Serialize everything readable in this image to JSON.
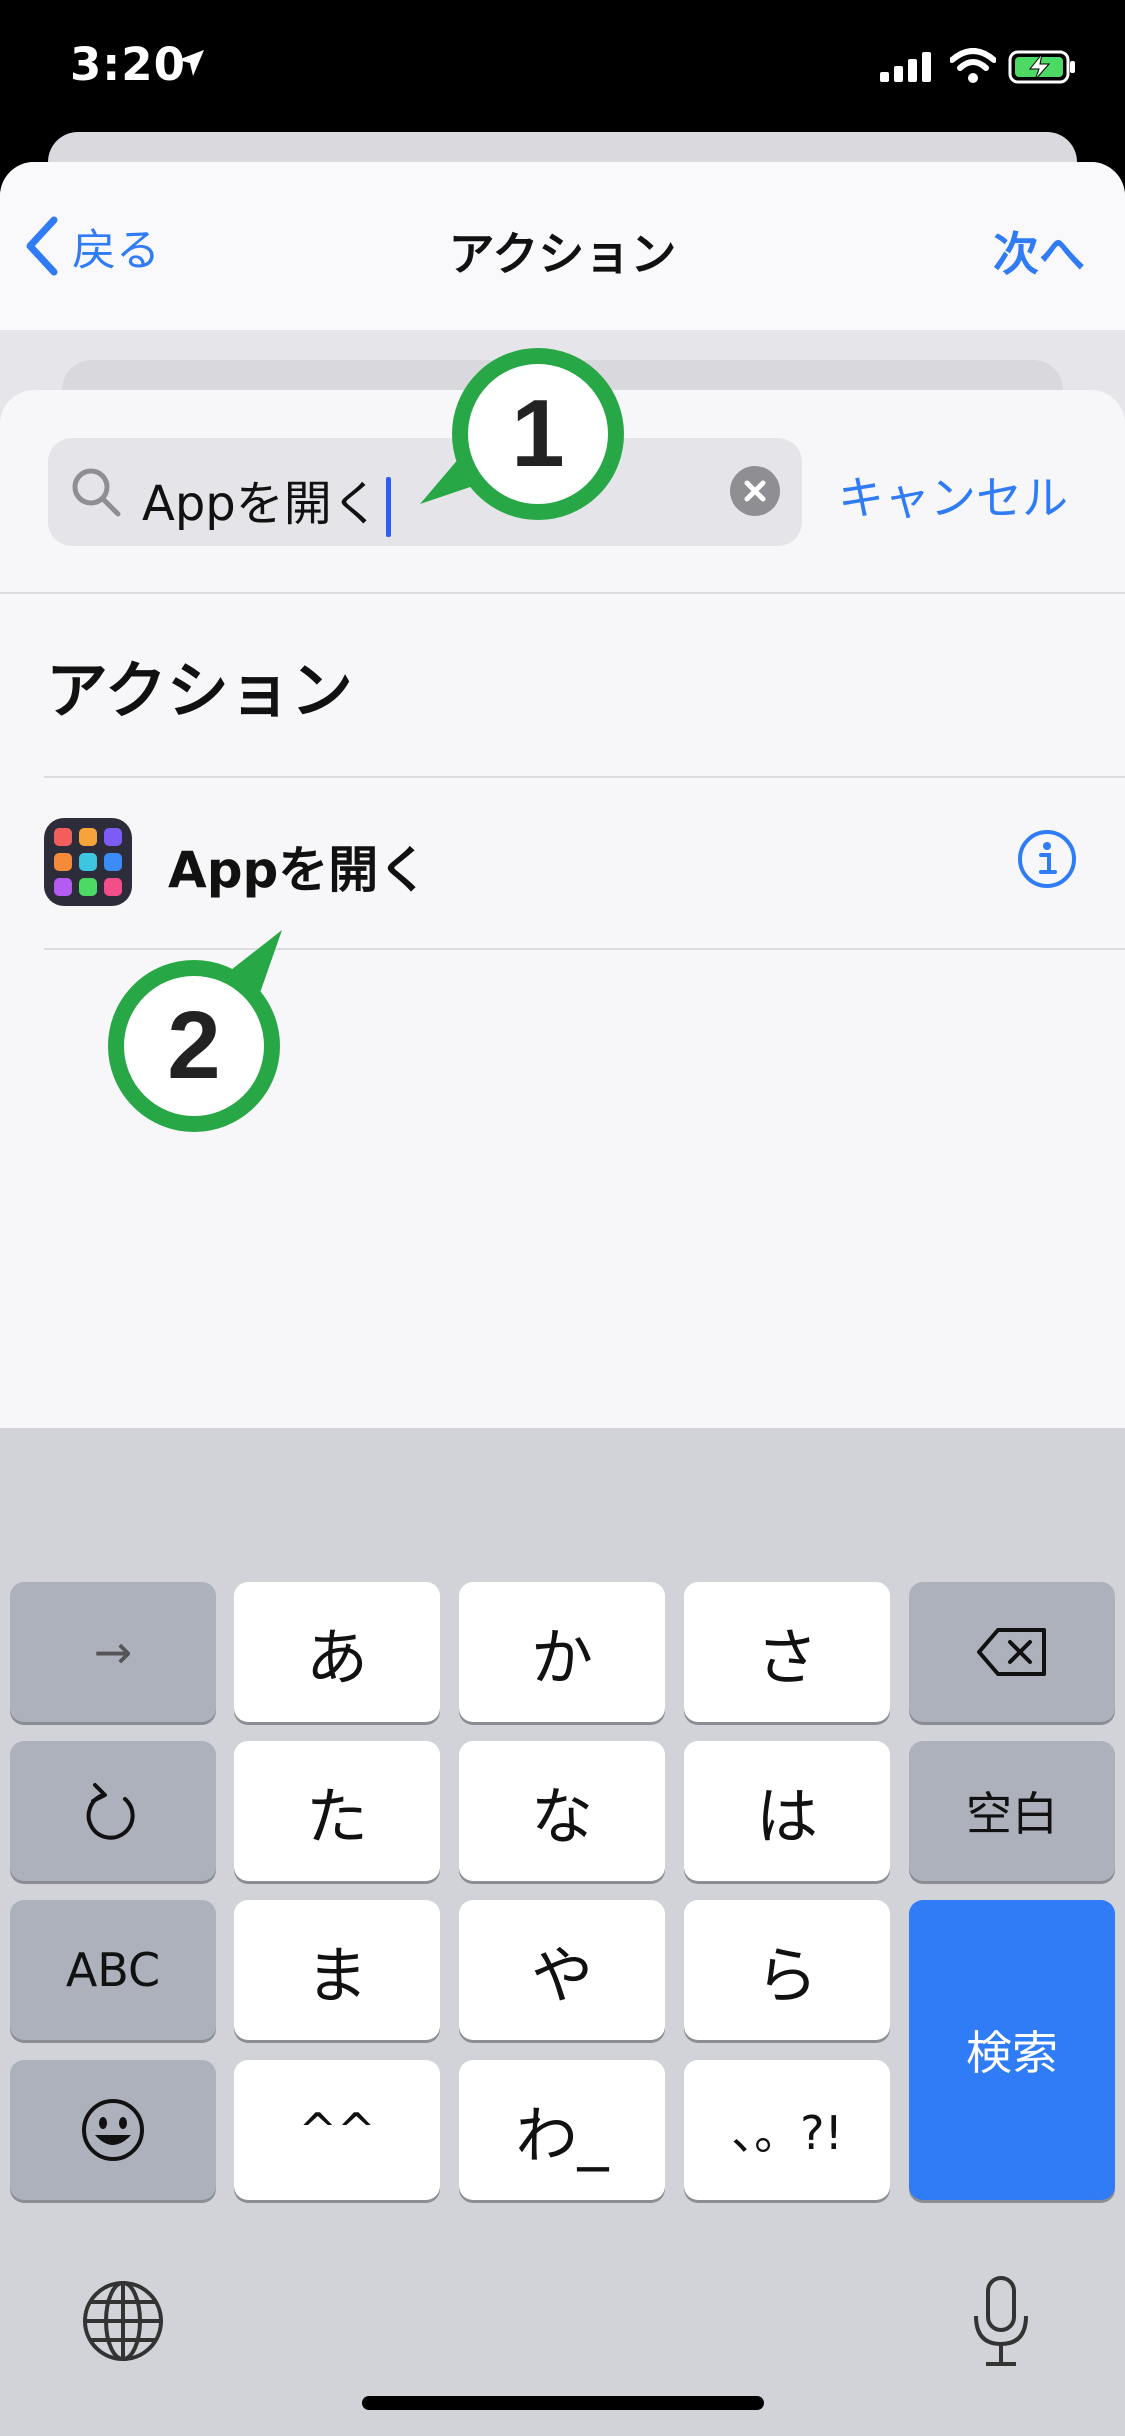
{
  "status_bar": {
    "time": "3:20"
  },
  "nav": {
    "back_label": "戻る",
    "title": "アクション",
    "next_label": "次へ"
  },
  "search": {
    "query": "Appを開く",
    "cancel_label": "キャンセル"
  },
  "section": {
    "title": "アクション"
  },
  "results": [
    {
      "label": "Appを開く"
    }
  ],
  "callouts": [
    "1",
    "2"
  ],
  "keyboard": {
    "row1": [
      "→",
      "あ",
      "か",
      "さ"
    ],
    "row2": [
      "た",
      "な",
      "は",
      "空白"
    ],
    "row3": [
      "ABC",
      "ま",
      "や",
      "ら"
    ],
    "row4": [
      "^^",
      "わ_",
      "、。?!"
    ],
    "search_key": "検索"
  },
  "colors": {
    "accent": "#2f7cf6",
    "callout_green": "#27a745",
    "return_key": "#2f7cf6"
  }
}
